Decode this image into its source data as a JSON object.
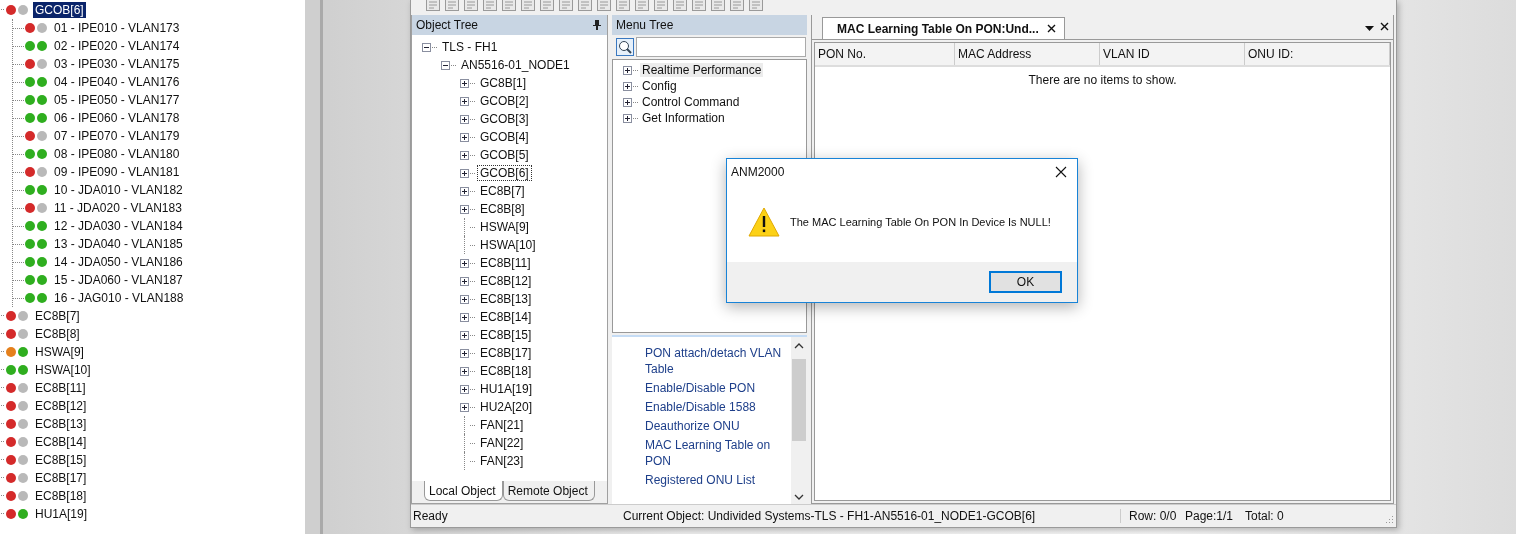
{
  "device_tree": {
    "items": [
      {
        "label": "GCOB[6]",
        "selected": true,
        "leds": [
          {
            "color": "#d42a2a"
          },
          {
            "color": "#b9b9b9"
          }
        ],
        "children": [
          {
            "label": "01 - IPE010 - VLAN173",
            "leds": [
              {
                "color": "#d42a2a"
              },
              {
                "color": "#b9b9b9"
              }
            ]
          },
          {
            "label": "02 - IPE020 - VLAN174",
            "leds": [
              {
                "color": "#2fae1f"
              },
              {
                "color": "#2fae1f"
              }
            ]
          },
          {
            "label": "03 - IPE030 - VLAN175",
            "leds": [
              {
                "color": "#d42a2a"
              },
              {
                "color": "#b9b9b9"
              }
            ]
          },
          {
            "label": "04 - IPE040 - VLAN176",
            "leds": [
              {
                "color": "#2fae1f"
              },
              {
                "color": "#2fae1f"
              }
            ]
          },
          {
            "label": "05 - IPE050 - VLAN177",
            "leds": [
              {
                "color": "#2fae1f"
              },
              {
                "color": "#2fae1f"
              }
            ]
          },
          {
            "label": "06 - IPE060 - VLAN178",
            "leds": [
              {
                "color": "#2fae1f"
              },
              {
                "color": "#2fae1f"
              }
            ]
          },
          {
            "label": "07 - IPE070 - VLAN179",
            "leds": [
              {
                "color": "#d42a2a"
              },
              {
                "color": "#b9b9b9"
              }
            ]
          },
          {
            "label": "08 - IPE080 - VLAN180",
            "leds": [
              {
                "color": "#2fae1f"
              },
              {
                "color": "#2fae1f"
              }
            ]
          },
          {
            "label": "09 - IPE090 - VLAN181",
            "leds": [
              {
                "color": "#d42a2a"
              },
              {
                "color": "#b9b9b9"
              }
            ]
          },
          {
            "label": "10 - JDA010 - VLAN182",
            "leds": [
              {
                "color": "#2fae1f"
              },
              {
                "color": "#2fae1f"
              }
            ]
          },
          {
            "label": "11 - JDA020 - VLAN183",
            "leds": [
              {
                "color": "#d42a2a"
              },
              {
                "color": "#b9b9b9"
              }
            ]
          },
          {
            "label": "12 - JDA030 - VLAN184",
            "leds": [
              {
                "color": "#2fae1f"
              },
              {
                "color": "#2fae1f"
              }
            ]
          },
          {
            "label": "13 - JDA040 - VLAN185",
            "leds": [
              {
                "color": "#2fae1f"
              },
              {
                "color": "#2fae1f"
              }
            ]
          },
          {
            "label": "14 - JDA050 - VLAN186",
            "leds": [
              {
                "color": "#2fae1f"
              },
              {
                "color": "#2fae1f"
              }
            ]
          },
          {
            "label": "15 - JDA060 - VLAN187",
            "leds": [
              {
                "color": "#2fae1f"
              },
              {
                "color": "#2fae1f"
              }
            ]
          },
          {
            "label": "16 - JAG010 - VLAN188",
            "leds": [
              {
                "color": "#2fae1f"
              },
              {
                "color": "#2fae1f"
              }
            ]
          }
        ]
      },
      {
        "label": "EC8B[7]",
        "selected": false,
        "leds": [
          {
            "color": "#d42a2a"
          },
          {
            "color": "#b9b9b9"
          }
        ]
      },
      {
        "label": "EC8B[8]",
        "selected": false,
        "leds": [
          {
            "color": "#d42a2a"
          },
          {
            "color": "#b9b9b9"
          }
        ]
      },
      {
        "label": "HSWA[9]",
        "selected": false,
        "leds": [
          {
            "color": "#e5801c"
          },
          {
            "color": "#2fae1f"
          }
        ]
      },
      {
        "label": "HSWA[10]",
        "selected": false,
        "leds": [
          {
            "color": "#2fae1f"
          },
          {
            "color": "#2fae1f"
          }
        ]
      },
      {
        "label": "EC8B[11]",
        "selected": false,
        "leds": [
          {
            "color": "#d42a2a"
          },
          {
            "color": "#b9b9b9"
          }
        ]
      },
      {
        "label": "EC8B[12]",
        "selected": false,
        "leds": [
          {
            "color": "#d42a2a"
          },
          {
            "color": "#b9b9b9"
          }
        ]
      },
      {
        "label": "EC8B[13]",
        "selected": false,
        "leds": [
          {
            "color": "#d42a2a"
          },
          {
            "color": "#b9b9b9"
          }
        ]
      },
      {
        "label": "EC8B[14]",
        "selected": false,
        "leds": [
          {
            "color": "#d42a2a"
          },
          {
            "color": "#b9b9b9"
          }
        ]
      },
      {
        "label": "EC8B[15]",
        "selected": false,
        "leds": [
          {
            "color": "#d42a2a"
          },
          {
            "color": "#b9b9b9"
          }
        ]
      },
      {
        "label": "EC8B[17]",
        "selected": false,
        "leds": [
          {
            "color": "#d42a2a"
          },
          {
            "color": "#b9b9b9"
          }
        ]
      },
      {
        "label": "EC8B[18]",
        "selected": false,
        "leds": [
          {
            "color": "#d42a2a"
          },
          {
            "color": "#b9b9b9"
          }
        ]
      },
      {
        "label": "HU1A[19]",
        "selected": false,
        "leds": [
          {
            "color": "#d42a2a"
          },
          {
            "color": "#2fae1f"
          }
        ]
      }
    ]
  },
  "object_tree": {
    "title": "Object Tree",
    "items": [
      {
        "label": "TLS - FH1",
        "kind": "expanded",
        "selected": false,
        "children": [
          {
            "label": "AN5516-01_NODE1",
            "kind": "expanded",
            "selected": false,
            "children": [
              {
                "label": "GC8B[1]",
                "kind": "collapsed",
                "selected": false
              },
              {
                "label": "GCOB[2]",
                "kind": "collapsed",
                "selected": false
              },
              {
                "label": "GCOB[3]",
                "kind": "collapsed",
                "selected": false
              },
              {
                "label": "GCOB[4]",
                "kind": "collapsed",
                "selected": false
              },
              {
                "label": "GCOB[5]",
                "kind": "collapsed",
                "selected": false
              },
              {
                "label": "GCOB[6]",
                "kind": "collapsed",
                "selected": true
              },
              {
                "label": "EC8B[7]",
                "kind": "collapsed",
                "selected": false
              },
              {
                "label": "EC8B[8]",
                "kind": "collapsed",
                "selected": false
              },
              {
                "label": "HSWA[9]",
                "kind": "leaf",
                "selected": false
              },
              {
                "label": "HSWA[10]",
                "kind": "leaf",
                "selected": false
              },
              {
                "label": "EC8B[11]",
                "kind": "collapsed",
                "selected": false
              },
              {
                "label": "EC8B[12]",
                "kind": "collapsed",
                "selected": false
              },
              {
                "label": "EC8B[13]",
                "kind": "collapsed",
                "selected": false
              },
              {
                "label": "EC8B[14]",
                "kind": "collapsed",
                "selected": false
              },
              {
                "label": "EC8B[15]",
                "kind": "collapsed",
                "selected": false
              },
              {
                "label": "EC8B[17]",
                "kind": "collapsed",
                "selected": false
              },
              {
                "label": "EC8B[18]",
                "kind": "collapsed",
                "selected": false
              },
              {
                "label": "HU1A[19]",
                "kind": "collapsed",
                "selected": false
              },
              {
                "label": "HU2A[20]",
                "kind": "collapsed",
                "selected": false
              },
              {
                "label": "FAN[21]",
                "kind": "leaf",
                "selected": false
              },
              {
                "label": "FAN[22]",
                "kind": "leaf",
                "selected": false
              },
              {
                "label": "FAN[23]",
                "kind": "leaf",
                "selected": false
              }
            ]
          }
        ]
      }
    ],
    "tabs": [
      {
        "label": "Local Object",
        "selected": true
      },
      {
        "label": "Remote Object",
        "selected": false
      }
    ]
  },
  "menu_tree": {
    "title": "Menu Tree",
    "items": [
      {
        "label": "Realtime Performance",
        "selected": true
      },
      {
        "label": "Config",
        "selected": false
      },
      {
        "label": "Control Command",
        "selected": false
      },
      {
        "label": "Get Information",
        "selected": false
      }
    ],
    "commands": [
      "PON attach/detach VLAN Table",
      "Enable/Disable PON",
      "Enable/Disable 1588",
      "Deauthorize ONU",
      "MAC Learning Table on PON",
      "Registered ONU List"
    ]
  },
  "document": {
    "tabs": [
      {
        "label": "MAC Learning Table On PON:Und...",
        "selected": true
      }
    ],
    "table": {
      "columns": [
        "PON No.",
        "MAC Address",
        "VLAN ID",
        "ONU ID:"
      ],
      "empty_text": "There are no items to show."
    }
  },
  "status_bar": {
    "state": "Ready",
    "current_object": "Current Object: Undivided Systems-TLS - FH1-AN5516-01_NODE1-GCOB[6]",
    "row": "Row: 0/0",
    "page": "Page:1/1",
    "total": "Total: 0"
  },
  "dialog": {
    "title": "ANM2000",
    "message": "The MAC Learning Table On PON In Device Is NULL!",
    "buttons": [
      {
        "label": "OK",
        "default": true
      }
    ]
  }
}
